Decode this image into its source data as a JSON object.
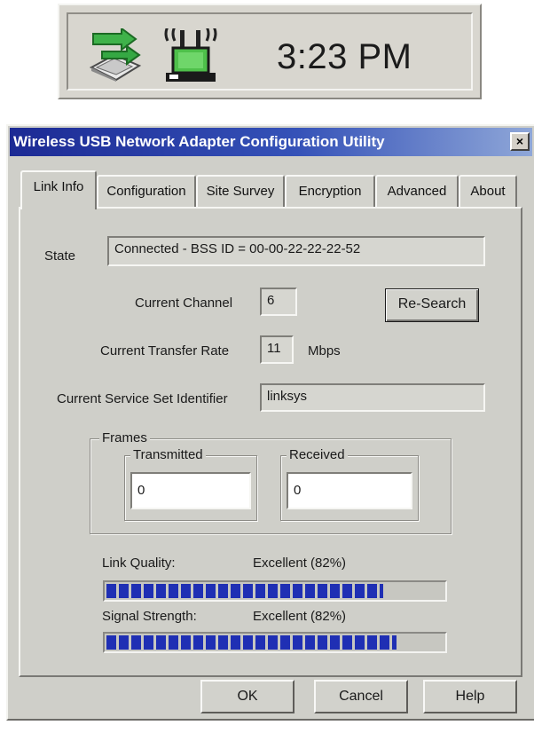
{
  "tray": {
    "clock": "3:23 PM",
    "icons": [
      "network-activity-icon",
      "wireless-antenna-icon"
    ]
  },
  "window": {
    "title": "Wireless USB Network Adapter Configuration Utility",
    "close_label": "×",
    "title_bar_color": "#1c2a94"
  },
  "tabs": [
    {
      "label": "Link Info",
      "active": true
    },
    {
      "label": "Configuration",
      "active": false
    },
    {
      "label": "Site Survey",
      "active": false
    },
    {
      "label": "Encryption",
      "active": false
    },
    {
      "label": "Advanced",
      "active": false
    },
    {
      "label": "About",
      "active": false
    }
  ],
  "link_info": {
    "state_label": "State",
    "state_value": "Connected - BSS ID = 00-00-22-22-22-52",
    "channel_label": "Current Channel",
    "channel_value": "6",
    "research_label": "Re-Search",
    "rate_label": "Current Transfer Rate",
    "rate_value": "11",
    "rate_unit": "Mbps",
    "ssid_label": "Current Service Set Identifier",
    "ssid_value": "linksys",
    "frames": {
      "title": "Frames",
      "transmitted_title": "Transmitted",
      "transmitted_value": "0",
      "received_title": "Received",
      "received_value": "0"
    },
    "link_quality": {
      "label": "Link Quality:",
      "value_text": "Excellent (82%)",
      "bar_level": 0.82
    },
    "signal_strength": {
      "label": "Signal Strength:",
      "value_text": "Excellent (82%)",
      "bar_level": 0.86
    },
    "bar_color": "#1f2fb4"
  },
  "buttons": {
    "ok": "OK",
    "cancel": "Cancel",
    "help": "Help"
  }
}
